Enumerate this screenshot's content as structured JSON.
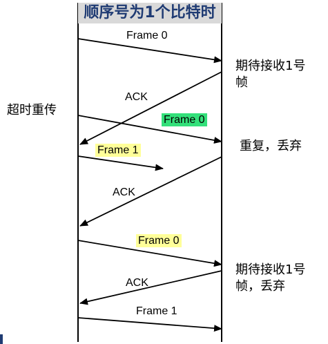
{
  "title": "顺序号为1个比特时",
  "left_label": "超时重传",
  "right_labels": {
    "r1_line1": "期待接收1号",
    "r1_line2": "帧",
    "r2": "重复，丢弃",
    "r3_line1": "期待接收1号",
    "r3_line2": "帧，丢弃"
  },
  "messages": {
    "m1": "Frame 0",
    "m2": "ACK",
    "m3": "Frame 0",
    "m4": "Frame 1",
    "m5": "ACK",
    "m6": "Frame 0",
    "m7": "ACK",
    "m8": "Frame 1"
  },
  "colors": {
    "title_bg": "#d9d9d9",
    "title_text": "#1f3b73",
    "highlight_green": "#33e07a",
    "highlight_yellow": "#ffff99"
  }
}
